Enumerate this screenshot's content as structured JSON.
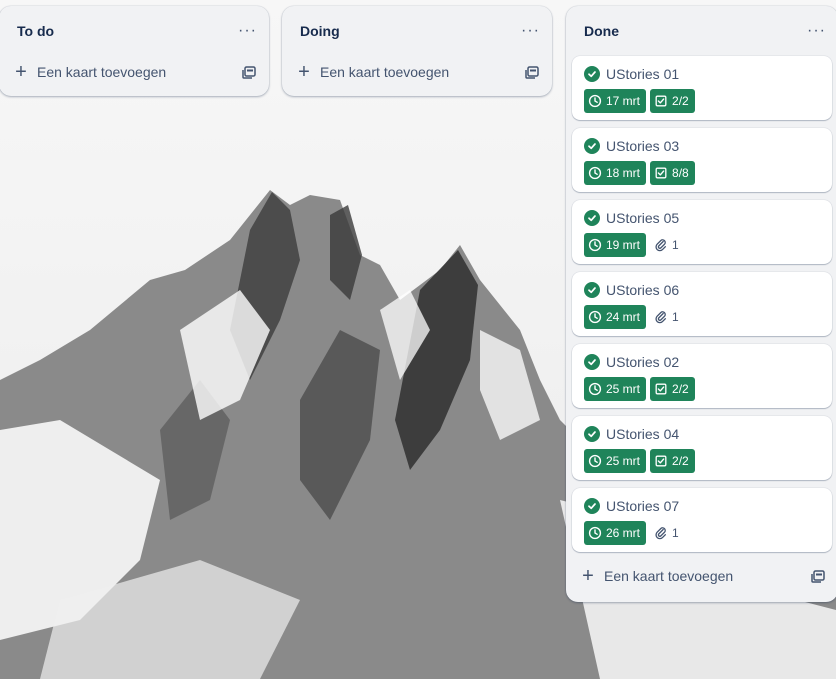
{
  "lists": [
    {
      "title": "To do",
      "add_label": "Een kaart toevoegen"
    },
    {
      "title": "Doing",
      "add_label": "Een kaart toevoegen"
    },
    {
      "title": "Done",
      "add_label": "Een kaart toevoegen",
      "cards": [
        {
          "title": "UStories 01",
          "date": "17 mrt",
          "checklist": "2/2"
        },
        {
          "title": "UStories 03",
          "date": "18 mrt",
          "checklist": "8/8"
        },
        {
          "title": "UStories 05",
          "date": "19 mrt",
          "attachments": "1"
        },
        {
          "title": "UStories 06",
          "date": "24 mrt",
          "attachments": "1"
        },
        {
          "title": "UStories 02",
          "date": "25 mrt",
          "checklist": "2/2"
        },
        {
          "title": "UStories 04",
          "date": "25 mrt",
          "checklist": "2/2"
        },
        {
          "title": "UStories 07",
          "date": "26 mrt",
          "attachments": "1"
        }
      ]
    }
  ],
  "menu_glyph": "···",
  "colors": {
    "complete_green": "#1f845a",
    "list_bg": "#f1f2f4",
    "text": "#172b4d",
    "subtle_text": "#44546f"
  }
}
